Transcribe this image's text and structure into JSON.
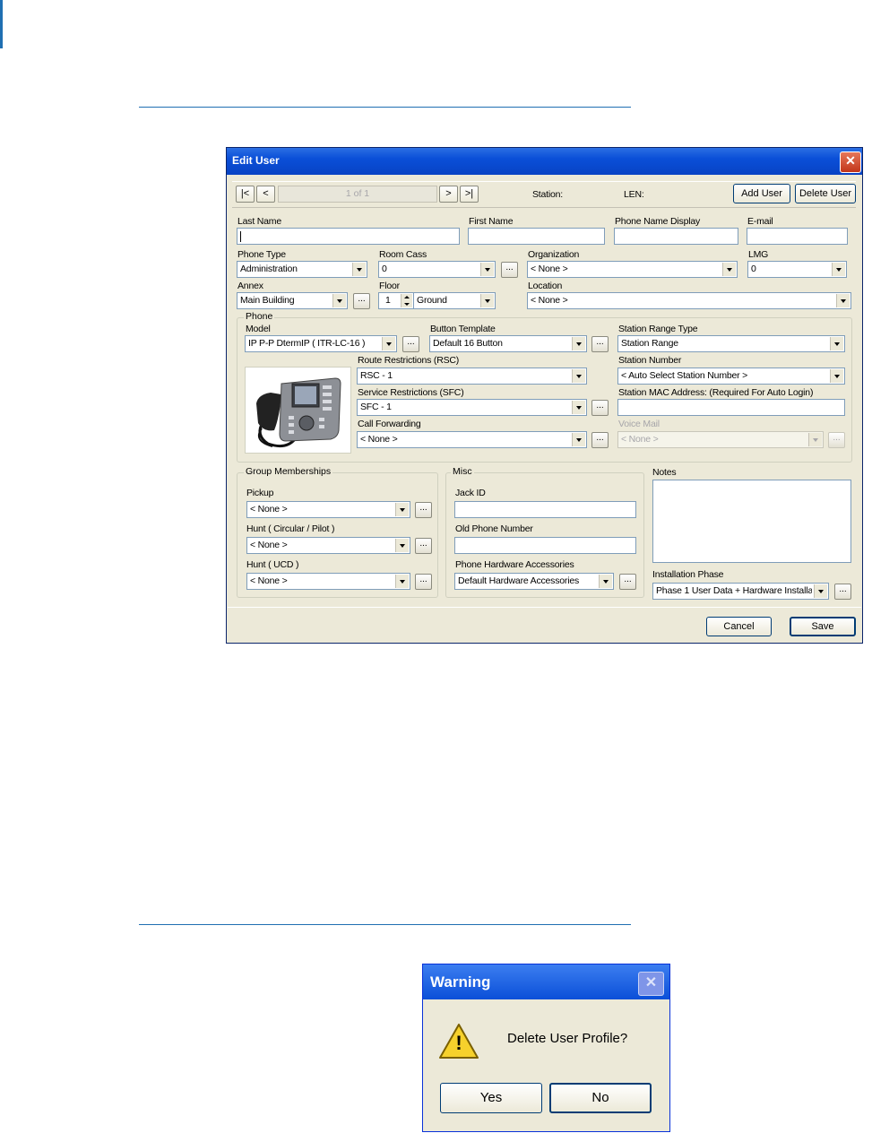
{
  "edit_user": {
    "title": "Edit User",
    "close_glyph": "✕",
    "nav": {
      "first": "|<",
      "prev": "<",
      "record": "1 of 1",
      "next": ">",
      "last": ">|"
    },
    "station_label": "Station:",
    "len_label": "LEN:",
    "add_user": "Add User",
    "delete_user": "Delete User",
    "last_name_label": "Last Name",
    "first_name_label": "First Name",
    "phone_name_display_label": "Phone Name Display",
    "email_label": "E-mail",
    "phone_type_label": "Phone Type",
    "phone_type_value": "Administration",
    "room_class_label": "Room Cass",
    "room_class_value": "0",
    "organization_label": "Organization",
    "organization_value": "< None >",
    "lmg_label": "LMG",
    "lmg_value": "0",
    "annex_label": "Annex",
    "annex_value": "Main Building",
    "floor_label": "Floor",
    "floor_number": "1",
    "floor_name": "Ground",
    "location_label": "Location",
    "location_value": "< None >",
    "phone_group": "Phone",
    "model_label": "Model",
    "model_value": "IP P-P DtermIP ( ITR-LC-16 )",
    "button_template_label": "Button Template",
    "button_template_value": "Default 16 Button",
    "station_range_type_label": "Station Range Type",
    "station_range_type_value": "Station Range",
    "route_restrictions_label": "Route Restrictions (RSC)",
    "route_restrictions_value": "RSC - 1",
    "station_number_label": "Station Number",
    "station_number_value": "< Auto Select Station Number >",
    "service_restrictions_label": "Service Restrictions (SFC)",
    "service_restrictions_value": "SFC - 1",
    "station_mac_label": "Station MAC Address: (Required For Auto Login)",
    "call_forwarding_label": "Call Forwarding",
    "call_forwarding_value": "< None >",
    "voice_mail_label": "Voice Mail",
    "voice_mail_value": "< None >",
    "group_memberships": "Group Memberships",
    "pickup_label": "Pickup",
    "pickup_value": "< None >",
    "hunt_circular_label": "Hunt ( Circular / Pilot )",
    "hunt_circular_value": "< None >",
    "hunt_ucd_label": "Hunt ( UCD )",
    "hunt_ucd_value": "< None >",
    "misc": "Misc",
    "jack_id_label": "Jack ID",
    "old_phone_label": "Old Phone Number",
    "hardware_accessories_label": "Phone Hardware Accessories",
    "hardware_accessories_value": "Default Hardware Accessories",
    "notes_label": "Notes",
    "installation_phase_label": "Installation Phase",
    "installation_phase_value": "Phase 1 User Data + Hardware Installa",
    "dots": "...",
    "cancel": "Cancel",
    "save": "Save"
  },
  "warning": {
    "title": "Warning",
    "close_glyph": "✕",
    "message": "Delete User Profile?",
    "icon_glyph": "!",
    "yes": "Yes",
    "no": "No"
  },
  "colors": {
    "accent_rule": "#1f6fb2",
    "window_bg": "#ece9d8",
    "title_blue": "#0a4fd8"
  }
}
